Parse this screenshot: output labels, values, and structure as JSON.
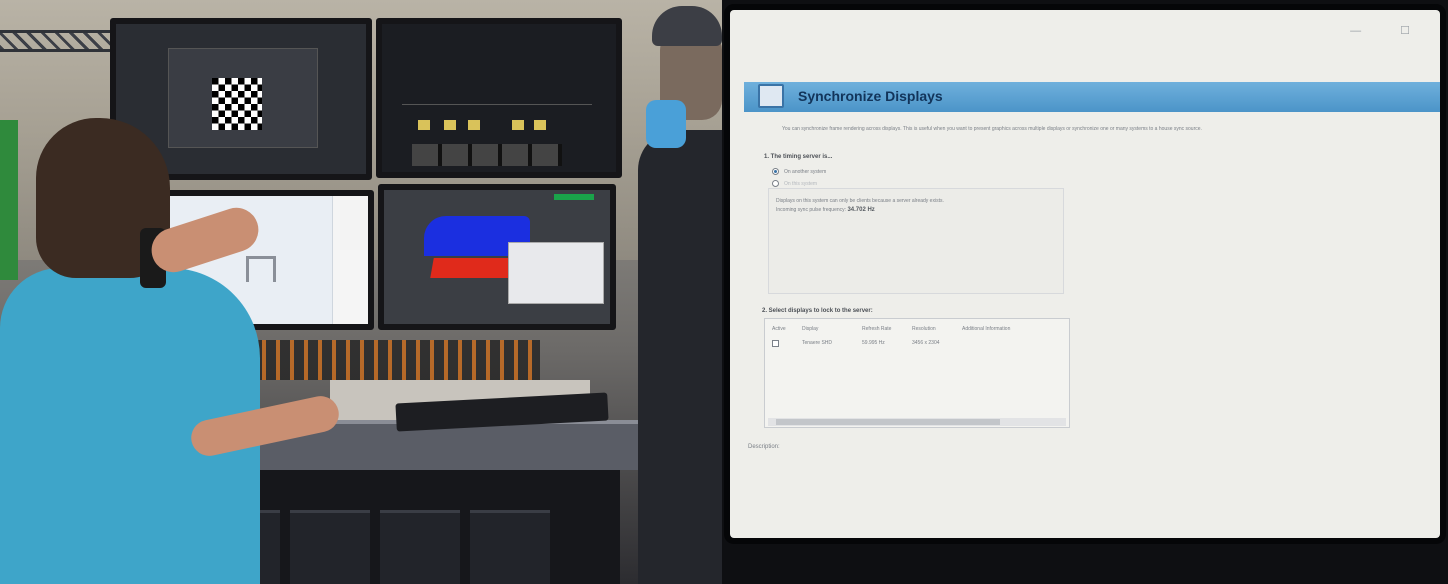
{
  "left_photo": {
    "description_icons": [
      "checkerboard-grid",
      "3d-shape"
    ]
  },
  "dialog": {
    "window_controls": "— ☐",
    "title": "Synchronize Displays",
    "description": "You can synchronize frame rendering across displays. This is useful when you want to present graphics across multiple displays or synchronize one or many systems to a house sync source.",
    "section1_title": "1. The timing server is...",
    "options": [
      {
        "label": "On another system",
        "selected": true
      },
      {
        "label": "On this system",
        "selected": false
      }
    ],
    "info_line1": "Displays on this system can only be clients because a server already exists.",
    "info_line2_prefix": "Incoming sync pulse frequency:",
    "info_line2_value": "34.702 Hz",
    "section2_title": "2. Select displays to lock to the server:",
    "table": {
      "headers": [
        "Active",
        "Display",
        "Refresh Rate",
        "Resolution",
        "Additional Information"
      ],
      "rows": [
        {
          "active": false,
          "display": "Tenaere SHD",
          "refresh_rate": "59.995 Hz",
          "resolution": "3456 x 2304",
          "info": ""
        }
      ]
    },
    "description_label": "Description:"
  },
  "colors": {
    "header_blue": "#4b94c8",
    "dialog_bg": "#eeeeea"
  }
}
